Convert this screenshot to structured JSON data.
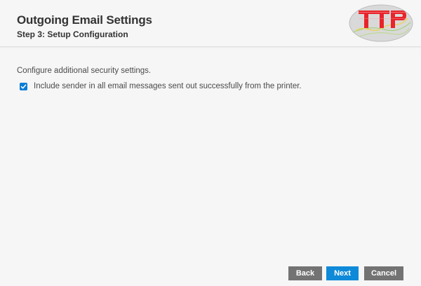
{
  "header": {
    "title": "Outgoing Email Settings",
    "subtitle": "Step 3: Setup Configuration"
  },
  "content": {
    "description": "Configure additional security settings.",
    "include_sender": {
      "checked": true,
      "label": "Include sender in all email messages sent out successfully from the printer."
    }
  },
  "buttons": {
    "back": "Back",
    "next": "Next",
    "cancel": "Cancel"
  },
  "colors": {
    "accent": "#0f8ad8",
    "secondary_button": "#737373",
    "logo_red": "#e8242a",
    "logo_oval": "#d9d9d9"
  }
}
